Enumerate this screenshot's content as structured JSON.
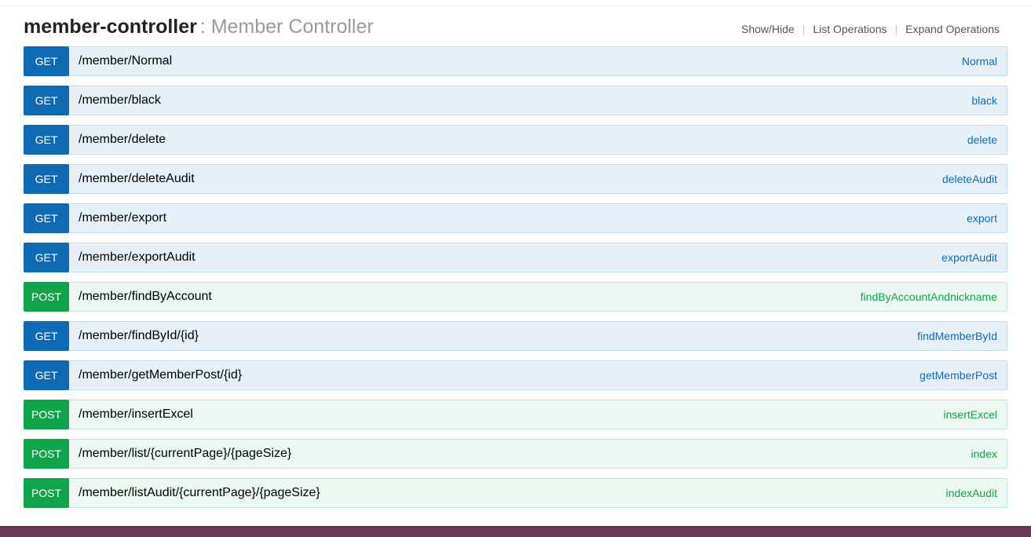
{
  "controller": {
    "name": "member-controller",
    "desc": "Member Controller"
  },
  "links": {
    "showHide": "Show/Hide",
    "listOps": "List Operations",
    "expandOps": "Expand Operations"
  },
  "methods": {
    "get": "GET",
    "post": "POST"
  },
  "endpoints": [
    {
      "method": "get",
      "path": "/member/Normal",
      "summary": "Normal"
    },
    {
      "method": "get",
      "path": "/member/black",
      "summary": "black"
    },
    {
      "method": "get",
      "path": "/member/delete",
      "summary": "delete"
    },
    {
      "method": "get",
      "path": "/member/deleteAudit",
      "summary": "deleteAudit"
    },
    {
      "method": "get",
      "path": "/member/export",
      "summary": "export"
    },
    {
      "method": "get",
      "path": "/member/exportAudit",
      "summary": "exportAudit"
    },
    {
      "method": "post",
      "path": "/member/findByAccount",
      "summary": "findByAccountAndnickname"
    },
    {
      "method": "get",
      "path": "/member/findById/{id}",
      "summary": "findMemberById"
    },
    {
      "method": "get",
      "path": "/member/getMemberPost/{id}",
      "summary": "getMemberPost"
    },
    {
      "method": "post",
      "path": "/member/insertExcel",
      "summary": "insertExcel"
    },
    {
      "method": "post",
      "path": "/member/list/{currentPage}/{pageSize}",
      "summary": "index"
    },
    {
      "method": "post",
      "path": "/member/listAudit/{currentPage}/{pageSize}",
      "summary": "indexAudit"
    }
  ]
}
